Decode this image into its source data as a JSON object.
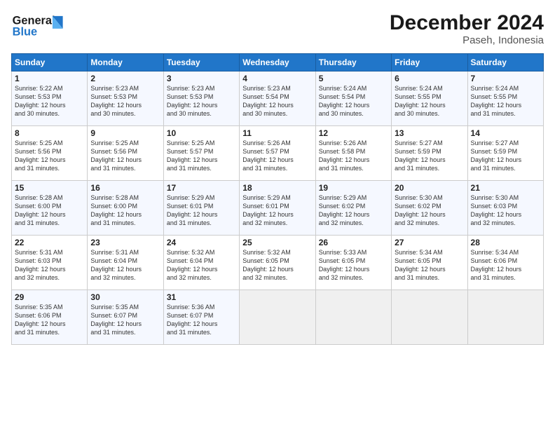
{
  "header": {
    "logo_line1": "General",
    "logo_line2": "Blue",
    "title": "December 2024",
    "subtitle": "Paseh, Indonesia"
  },
  "weekdays": [
    "Sunday",
    "Monday",
    "Tuesday",
    "Wednesday",
    "Thursday",
    "Friday",
    "Saturday"
  ],
  "weeks": [
    [
      {
        "day": "1",
        "info": "Sunrise: 5:22 AM\nSunset: 5:53 PM\nDaylight: 12 hours\nand 30 minutes."
      },
      {
        "day": "2",
        "info": "Sunrise: 5:23 AM\nSunset: 5:53 PM\nDaylight: 12 hours\nand 30 minutes."
      },
      {
        "day": "3",
        "info": "Sunrise: 5:23 AM\nSunset: 5:53 PM\nDaylight: 12 hours\nand 30 minutes."
      },
      {
        "day": "4",
        "info": "Sunrise: 5:23 AM\nSunset: 5:54 PM\nDaylight: 12 hours\nand 30 minutes."
      },
      {
        "day": "5",
        "info": "Sunrise: 5:24 AM\nSunset: 5:54 PM\nDaylight: 12 hours\nand 30 minutes."
      },
      {
        "day": "6",
        "info": "Sunrise: 5:24 AM\nSunset: 5:55 PM\nDaylight: 12 hours\nand 30 minutes."
      },
      {
        "day": "7",
        "info": "Sunrise: 5:24 AM\nSunset: 5:55 PM\nDaylight: 12 hours\nand 31 minutes."
      }
    ],
    [
      {
        "day": "8",
        "info": "Sunrise: 5:25 AM\nSunset: 5:56 PM\nDaylight: 12 hours\nand 31 minutes."
      },
      {
        "day": "9",
        "info": "Sunrise: 5:25 AM\nSunset: 5:56 PM\nDaylight: 12 hours\nand 31 minutes."
      },
      {
        "day": "10",
        "info": "Sunrise: 5:25 AM\nSunset: 5:57 PM\nDaylight: 12 hours\nand 31 minutes."
      },
      {
        "day": "11",
        "info": "Sunrise: 5:26 AM\nSunset: 5:57 PM\nDaylight: 12 hours\nand 31 minutes."
      },
      {
        "day": "12",
        "info": "Sunrise: 5:26 AM\nSunset: 5:58 PM\nDaylight: 12 hours\nand 31 minutes."
      },
      {
        "day": "13",
        "info": "Sunrise: 5:27 AM\nSunset: 5:59 PM\nDaylight: 12 hours\nand 31 minutes."
      },
      {
        "day": "14",
        "info": "Sunrise: 5:27 AM\nSunset: 5:59 PM\nDaylight: 12 hours\nand 31 minutes."
      }
    ],
    [
      {
        "day": "15",
        "info": "Sunrise: 5:28 AM\nSunset: 6:00 PM\nDaylight: 12 hours\nand 31 minutes."
      },
      {
        "day": "16",
        "info": "Sunrise: 5:28 AM\nSunset: 6:00 PM\nDaylight: 12 hours\nand 31 minutes."
      },
      {
        "day": "17",
        "info": "Sunrise: 5:29 AM\nSunset: 6:01 PM\nDaylight: 12 hours\nand 31 minutes."
      },
      {
        "day": "18",
        "info": "Sunrise: 5:29 AM\nSunset: 6:01 PM\nDaylight: 12 hours\nand 32 minutes."
      },
      {
        "day": "19",
        "info": "Sunrise: 5:29 AM\nSunset: 6:02 PM\nDaylight: 12 hours\nand 32 minutes."
      },
      {
        "day": "20",
        "info": "Sunrise: 5:30 AM\nSunset: 6:02 PM\nDaylight: 12 hours\nand 32 minutes."
      },
      {
        "day": "21",
        "info": "Sunrise: 5:30 AM\nSunset: 6:03 PM\nDaylight: 12 hours\nand 32 minutes."
      }
    ],
    [
      {
        "day": "22",
        "info": "Sunrise: 5:31 AM\nSunset: 6:03 PM\nDaylight: 12 hours\nand 32 minutes."
      },
      {
        "day": "23",
        "info": "Sunrise: 5:31 AM\nSunset: 6:04 PM\nDaylight: 12 hours\nand 32 minutes."
      },
      {
        "day": "24",
        "info": "Sunrise: 5:32 AM\nSunset: 6:04 PM\nDaylight: 12 hours\nand 32 minutes."
      },
      {
        "day": "25",
        "info": "Sunrise: 5:32 AM\nSunset: 6:05 PM\nDaylight: 12 hours\nand 32 minutes."
      },
      {
        "day": "26",
        "info": "Sunrise: 5:33 AM\nSunset: 6:05 PM\nDaylight: 12 hours\nand 32 minutes."
      },
      {
        "day": "27",
        "info": "Sunrise: 5:34 AM\nSunset: 6:05 PM\nDaylight: 12 hours\nand 31 minutes."
      },
      {
        "day": "28",
        "info": "Sunrise: 5:34 AM\nSunset: 6:06 PM\nDaylight: 12 hours\nand 31 minutes."
      }
    ],
    [
      {
        "day": "29",
        "info": "Sunrise: 5:35 AM\nSunset: 6:06 PM\nDaylight: 12 hours\nand 31 minutes."
      },
      {
        "day": "30",
        "info": "Sunrise: 5:35 AM\nSunset: 6:07 PM\nDaylight: 12 hours\nand 31 minutes."
      },
      {
        "day": "31",
        "info": "Sunrise: 5:36 AM\nSunset: 6:07 PM\nDaylight: 12 hours\nand 31 minutes."
      },
      null,
      null,
      null,
      null
    ]
  ]
}
